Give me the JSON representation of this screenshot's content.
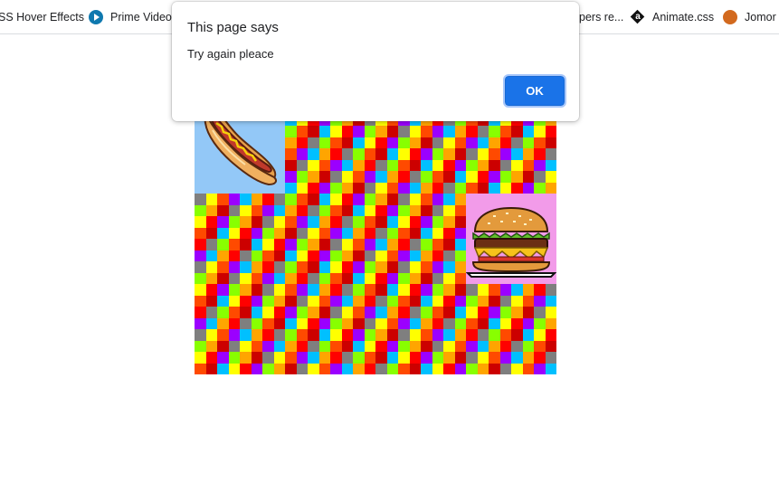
{
  "bookmarks_bar": {
    "items": [
      {
        "label": "SS Hover Effects",
        "icon": "bookmark-favicon"
      },
      {
        "label": "Prime Video:",
        "icon": "prime-video-icon"
      },
      {
        "label": "pers re...",
        "icon": "bookmark-favicon"
      },
      {
        "label": "Animate.css",
        "icon": "animate-css-icon"
      },
      {
        "label": "Jomor I",
        "icon": "jomor-icon"
      }
    ]
  },
  "dialog": {
    "title": "This page says",
    "message": "Try again pleace",
    "ok_label": "OK",
    "ok_color": "#1a73e8"
  },
  "artwork": {
    "tiles": [
      {
        "name": "hotdog-tile",
        "background": "#93c8f7"
      },
      {
        "name": "burger-tile",
        "background": "#f29be9"
      }
    ],
    "palette": [
      "#ff0000",
      "#ff4a00",
      "#ffa500",
      "#ffff00",
      "#88ff00",
      "#00c0ff",
      "#7f7f7f",
      "#9b00ff",
      "#cc0000"
    ]
  }
}
